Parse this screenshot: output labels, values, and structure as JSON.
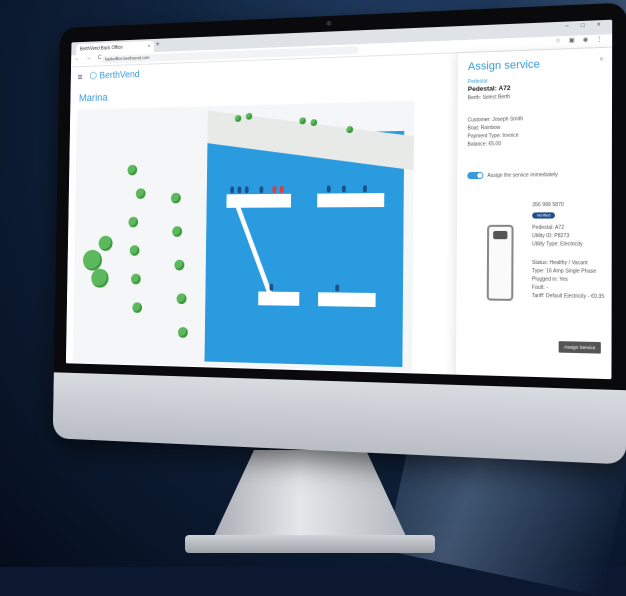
{
  "browser": {
    "tab_title": "BerthVend Back Office",
    "tab_close": "×",
    "new_tab": "+",
    "window_controls": "– □ ×",
    "nav_buttons": "← → C",
    "url": "backoffice.berthvend.com",
    "ext_icons": "☆ ▣ ◉ ⋮"
  },
  "app": {
    "menu_icon": "hamburger-icon",
    "logo_text": "BerthVend",
    "page_title": "Marina"
  },
  "panel": {
    "title": "Assign service",
    "close": "×",
    "section_label": "Pedestal",
    "pedestal_name": "Pedestal: A72",
    "berth": "Berth: Select Berth",
    "customer": "Customer: Joseph Smith",
    "boat": "Boat: Rainbow",
    "payment_type": "Payment Type: Invoice",
    "balance": "Balance: €5.00",
    "toggle_label": "Assign the service immediately",
    "phone": "356 999 5870",
    "badge": "Verified",
    "pedestal_id": "Pedestal: A72",
    "utility_id": "Utility ID: P8273",
    "utility_type": "Utility Type: Electricity",
    "status": "Status: Healthy / Vacant",
    "type": "Type: 16 Amp Single Phase",
    "plugged_in": "Plugged in: Yes",
    "fault": "Fault: -",
    "tariff": "Tariff: Default Electricity - €0.35",
    "assign_button": "Assign Service"
  },
  "colors": {
    "accent": "#3a9ad9",
    "water": "#2b9be0",
    "tree": "#5cb85c",
    "badge": "#1f4e8c"
  }
}
